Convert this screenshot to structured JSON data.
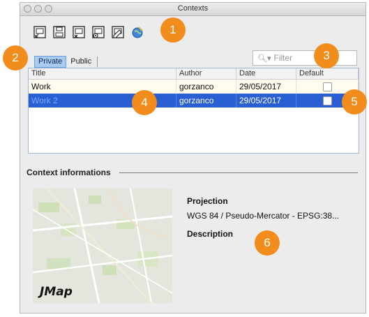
{
  "window": {
    "title": "Contexts"
  },
  "toolbar": {
    "buttons": [
      {
        "icon": "context-open-icon"
      },
      {
        "icon": "context-save-icon"
      },
      {
        "icon": "context-delete-icon"
      },
      {
        "icon": "context-settings-icon"
      },
      {
        "icon": "context-edit-icon"
      },
      {
        "icon": "globe-icon"
      }
    ]
  },
  "tabs": {
    "private": "Private",
    "public": "Public"
  },
  "filter": {
    "placeholder": "Filter"
  },
  "table": {
    "headers": [
      "Title",
      "Author",
      "Date",
      "Default"
    ],
    "rows": [
      {
        "title": "Work",
        "author": "gorzanco",
        "date": "29/05/2017",
        "default": false
      },
      {
        "title": "Work 2",
        "author": "gorzanco",
        "date": "29/05/2017",
        "default": false
      }
    ]
  },
  "info": {
    "section": "Context informations",
    "projection_label": "Projection",
    "projection_value": "WGS 84 / Pseudo-Mercator - EPSG:38...",
    "description_label": "Description",
    "logo_text": "JMap"
  },
  "callouts": [
    "1",
    "2",
    "3",
    "4",
    "5",
    "6"
  ],
  "colors": {
    "accent": "#f28c1c",
    "selection": "#2a5fd3"
  }
}
